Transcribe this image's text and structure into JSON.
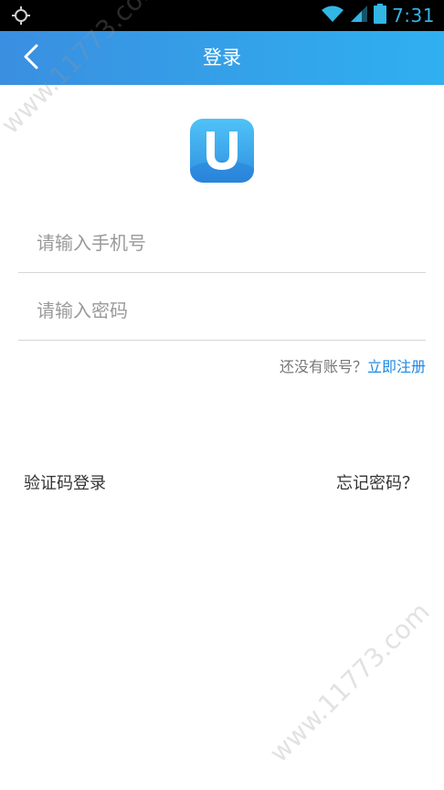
{
  "status_bar": {
    "time": "7:31",
    "icons": [
      "gps-icon",
      "wifi-icon",
      "signal-icon",
      "battery-icon"
    ]
  },
  "header": {
    "title": "登录",
    "back_icon": "chevron-left-icon",
    "gradient_start": "#3a8fe0",
    "gradient_end": "#2fb0f0"
  },
  "logo": {
    "letter": "U"
  },
  "form": {
    "phone_placeholder": "请输入手机号",
    "phone_value": "",
    "password_placeholder": "请输入密码",
    "password_value": ""
  },
  "register": {
    "prompt": "还没有账号？",
    "link_label": "立即注册",
    "link_color": "#1e88e5"
  },
  "bottom_links": {
    "sms_login": "验证码登录",
    "forgot_password": "忘记密码？"
  },
  "watermark": {
    "text": "www.11773.com"
  }
}
